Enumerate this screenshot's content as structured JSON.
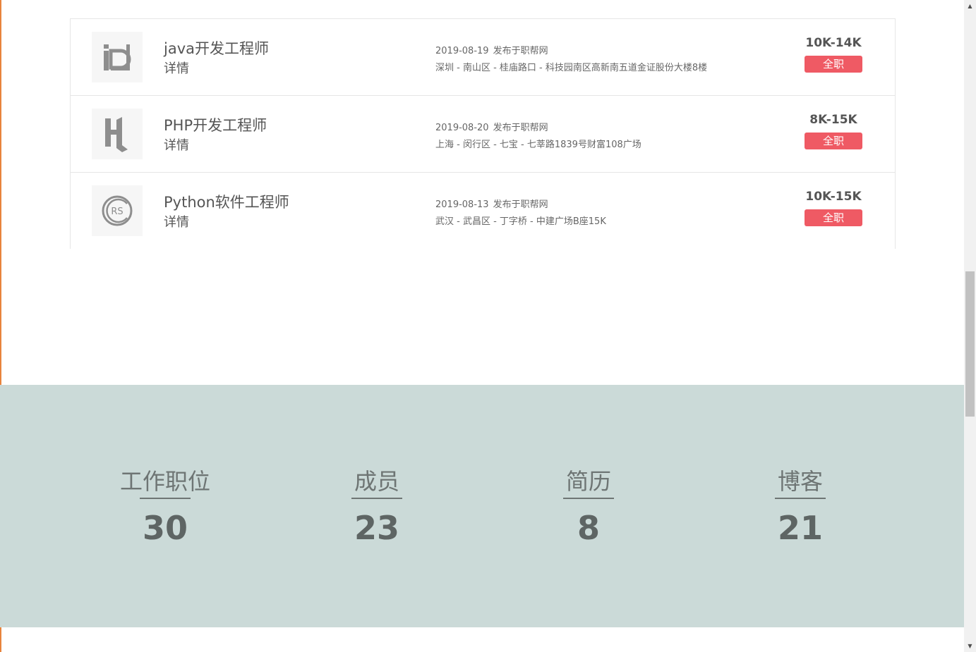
{
  "jobs": [
    {
      "logo_icon": "id-logo-icon",
      "title": "java开发工程师",
      "detail_label": "详情",
      "date": "2019-08-19",
      "source": "发布于职帮网",
      "location": "深圳 - 南山区 - 桂庙路口 - 科技园南区高新南五道金证股份大楼8楼",
      "salary": "10K-14K",
      "type": "全职"
    },
    {
      "logo_icon": "h-logo-icon",
      "title": "PHP开发工程师",
      "detail_label": "详情",
      "date": "2019-08-20",
      "source": "发布于职帮网",
      "location": "上海 - 闵行区 - 七宝 - 七莘路1839号财富108广场",
      "salary": "8K-15K",
      "type": "全职"
    },
    {
      "logo_icon": "rs-logo-icon",
      "title": "Python软件工程师",
      "detail_label": "详情",
      "date": "2019-08-13",
      "source": "发布于职帮网",
      "location": "武汉 - 武昌区 - 丁字桥 - 中建广场B座15K",
      "salary": "10K-15K",
      "type": "全职"
    }
  ],
  "stats": [
    {
      "label": "工作职位",
      "value": "30"
    },
    {
      "label": "成员",
      "value": "23"
    },
    {
      "label": "简历",
      "value": "8"
    },
    {
      "label": "博客",
      "value": "21"
    }
  ],
  "colors": {
    "tag": "#ef5a64",
    "stats_band": "#cbdad8",
    "accent": "#e8843c"
  }
}
